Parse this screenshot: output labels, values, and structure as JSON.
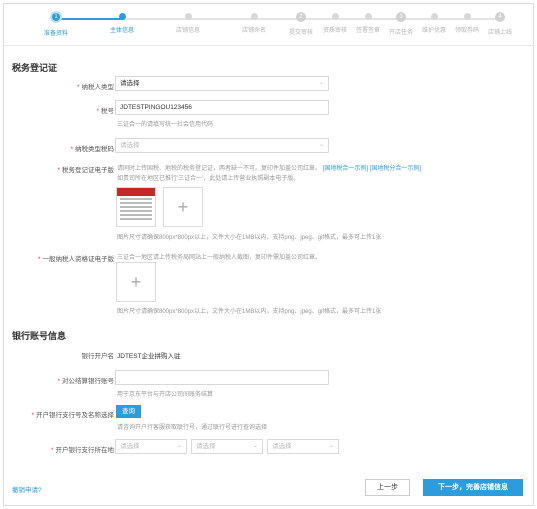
{
  "stepper": {
    "steps": [
      {
        "label": "准备资料",
        "num": "1"
      },
      {
        "label": "主体信息",
        "num": ""
      },
      {
        "label": "店铺信息",
        "num": ""
      },
      {
        "label": "店铺命名",
        "num": ""
      },
      {
        "label": "提交审核",
        "num": "2"
      },
      {
        "label": "资质审核",
        "num": ""
      },
      {
        "label": "签署签章",
        "num": ""
      },
      {
        "label": "开店任务",
        "num": "3"
      },
      {
        "label": "维护优惠",
        "num": ""
      },
      {
        "label": "领取券码",
        "num": ""
      },
      {
        "label": "店铺上线",
        "num": "4"
      }
    ]
  },
  "tax": {
    "title": "税务登记证",
    "taxpayer_type_label": "纳税人类型",
    "taxpayer_type_value": "请选择",
    "tax_no_label": "税号",
    "tax_no_value": "JDTESTPINGOU123456",
    "tax_no_hint": "三证合一的请填写统一社会信用代码",
    "tax_code_label": "纳税类型税码",
    "tax_code_placeholder": "请选择",
    "ecert_label": "税务登记证电子版",
    "ecert_hint_1": "请同时上传国税、地税的税务登记证，两者缺一不可。复印件加盖公司红章。",
    "ecert_link_1": "[国地税合一示例]",
    "ecert_link_2": "[国地税分合一示例]",
    "ecert_hint_2": "如贵司所在地区已推行'三证合一'，此处请上传营业执照副本电子版。",
    "ecert_size_hint": "图片尺寸请确保800px*800px以上，文件大小在1MB以内，支持png、jpeg、gif格式，最多可上传1张",
    "general_label": "一般纳税人资格证电子版",
    "general_hint": "三证合一地区请上传税务局网站上一般纳税人截图，复印件需加盖公司红章。",
    "general_size_hint": "图片尺寸请确保800px*800px以上，文件大小在1MB以内，支持png、jpeg、gif格式，最多可上传1张",
    "upload_plus": "+"
  },
  "bank": {
    "title": "银行账号信息",
    "account_name_label": "银行开户名",
    "account_name_value": "JDTEST企业拼购入驻",
    "account_no_label": "对公结算银行账号",
    "account_no_hint": "用于京东平台与开店公司间账务结算",
    "branch_label": "开户银行支行号及名称选择",
    "query_button": "查询",
    "branch_hint": "请咨询开户行客服获取联行号，通过联行号进行查询选择",
    "location_label": "开户银行支行所在地",
    "location_placeholder_1": "请选择",
    "location_placeholder_2": "请选择",
    "location_placeholder_3": "请选择"
  },
  "footer": {
    "cancel_link": "撤销申请?",
    "prev_button": "上一步",
    "next_button": "下一步，完善店铺信息"
  },
  "colors": {
    "accent": "#2d9cdb",
    "required": "#e4393c"
  }
}
